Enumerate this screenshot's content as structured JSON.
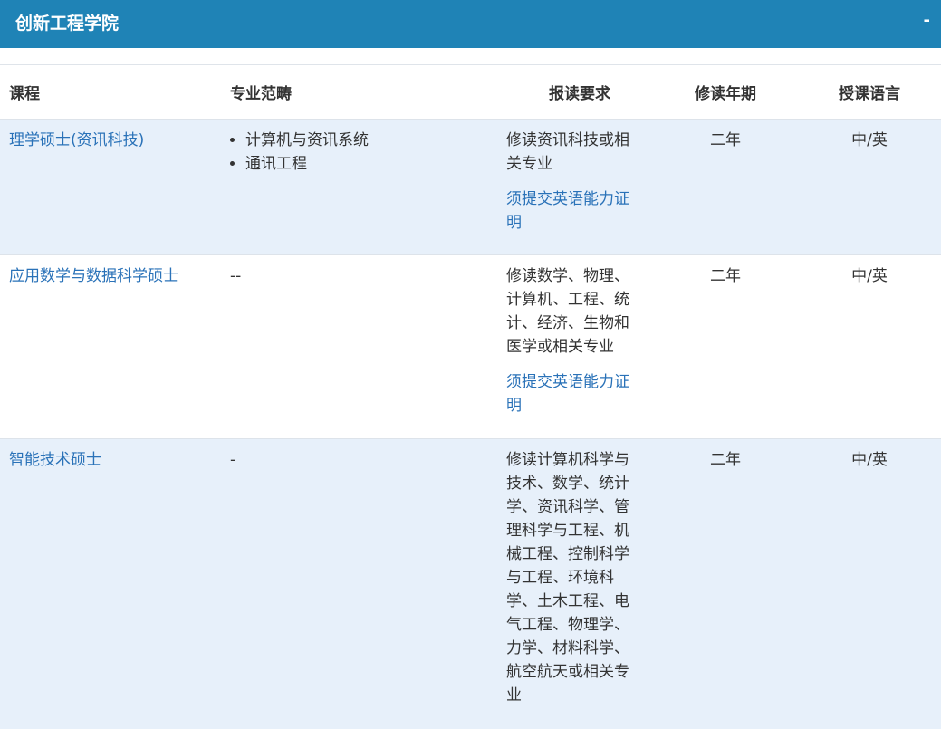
{
  "panel": {
    "title": "创新工程学院",
    "toggle": "-"
  },
  "table": {
    "headers": {
      "course": "课程",
      "scope": "专业范畴",
      "requirement": "报读要求",
      "years": "修读年期",
      "language": "授课语言"
    },
    "rows": [
      {
        "course": "理学硕士(资讯科技)",
        "scope_items": [
          "计算机与资讯系统",
          "通讯工程"
        ],
        "scope_text": "",
        "requirement": "修读资讯科技或相关专业",
        "language_requirement": "须提交英语能力证明",
        "years": "二年",
        "language": "中/英"
      },
      {
        "course": "应用数学与数据科学硕士",
        "scope_items": [],
        "scope_text": "--",
        "requirement": "修读数学、物理、计算机、工程、统计、经济、生物和医学或相关专业",
        "language_requirement": "须提交英语能力证明",
        "years": "二年",
        "language": "中/英"
      },
      {
        "course": "智能技术硕士",
        "scope_items": [],
        "scope_text": "-",
        "requirement": "修读计算机科学与技术、数学、统计学、资讯科学、管理科学与工程、机械工程、控制科学与工程、环境科学、土木工程、电气工程、物理学、力学、材料科学、航空航天或相关专业",
        "language_requirement": "",
        "years": "二年",
        "language": "中/英"
      }
    ]
  }
}
